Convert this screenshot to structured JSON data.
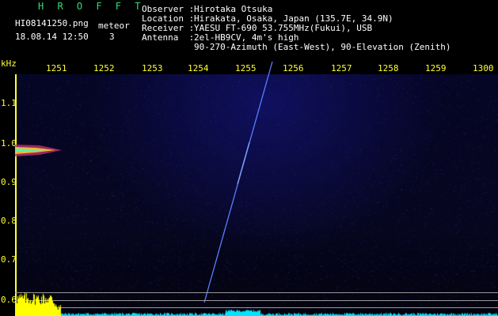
{
  "app": {
    "title": "H R O F F T",
    "filename": "HI08141250.png",
    "timestamp": "18.08.14 12:50",
    "meteor_label": "meteor",
    "meteor_count": "3"
  },
  "info": {
    "observer_label": "Observer :",
    "observer": "Hirotaka Otsuka",
    "location_label": "Location :",
    "location": "Hirakata, Osaka, Japan (135.7E, 34.9N)",
    "receiver_label": "Receiver :",
    "receiver": "YAESU FT-690 53.755MHz(Fukui), USB",
    "antenna_label": "Antenna  :",
    "antenna_line1": "2el-HB9CV, 4m's high",
    "antenna_line2": "90-270-Azimuth (East-West), 90-Elevation (Zenith)"
  },
  "axes": {
    "y_unit": "kHz",
    "y_ticks": [
      "1.1",
      "1.0",
      "0.9",
      "0.8",
      "0.7",
      "0.6"
    ],
    "x_ticks": [
      "1251",
      "1252",
      "1253",
      "1254",
      "1255",
      "1256",
      "1257",
      "1258",
      "1259",
      "1300"
    ]
  },
  "colors": {
    "background": "#000000",
    "label_text": "#ffffff",
    "axis_text": "#ffff33",
    "title_text": "#33dd77",
    "meteor_trace": "#5a7dff",
    "yellow_level": "#ffff00",
    "cyan_level": "#00e5ff"
  }
}
